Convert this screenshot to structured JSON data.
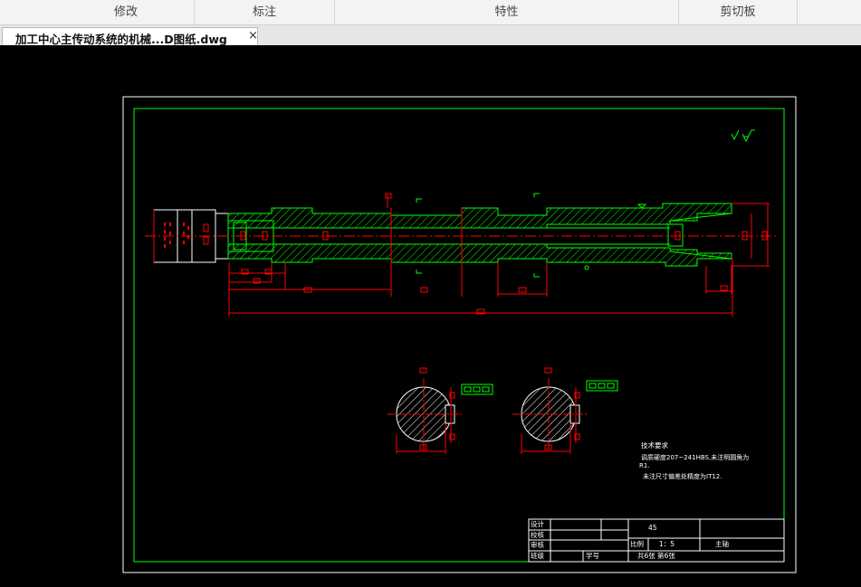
{
  "ribbon": {
    "groups": [
      {
        "label": "修改"
      },
      {
        "label": "标注"
      },
      {
        "label": "特性"
      },
      {
        "label": "剪切板"
      }
    ]
  },
  "document_tab": {
    "title": "加工中心主传动系统的机械...D图纸.dwg",
    "close_glyph": "×"
  },
  "drawing": {
    "tech_req_title": "技术要求",
    "tech_req_line1": "调质硬度207~241HBS,未注明圆角为",
    "tech_req_line2": "R1.",
    "tech_req_line3": "未注尺寸偏差处精度为IT12.",
    "title_block": {
      "design": "设计",
      "check": "校核",
      "review": "审核",
      "class": "班级",
      "student_no": "学号",
      "material": "45",
      "scale_label": "比例",
      "scale_value": "1：5",
      "part_name": "主轴",
      "sheets": "共6张  第6张"
    }
  },
  "colors": {
    "outline": "#ffffff",
    "inner_frame": "#00ff00",
    "dimension": "#ff0000",
    "hatch": "#00ff00"
  }
}
